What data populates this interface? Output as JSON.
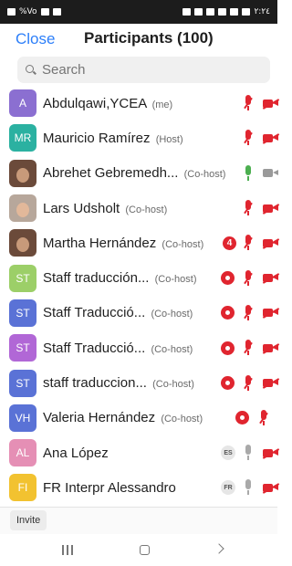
{
  "statusbar": {
    "left_text": "%Vo",
    "right_text": "۲:۲٤"
  },
  "header": {
    "close_label": "Close",
    "title": "Participants (100)"
  },
  "search": {
    "placeholder": "Search"
  },
  "participants": [
    {
      "initials": "A",
      "color": "#8b6fd1",
      "name": "Abdulqawi,YCEA",
      "role": "(me)"
    },
    {
      "initials": "MR",
      "color": "#2bb1a1",
      "name": "Mauricio Ramírez",
      "role": "(Host)"
    },
    {
      "initials": "",
      "color": "#6b4a3a",
      "name": "Abrehet Gebremedh...",
      "role": "(Co-host)"
    },
    {
      "initials": "",
      "color": "#b7a79b",
      "name": "Lars Udsholt",
      "role": "(Co-host)"
    },
    {
      "initials": "",
      "color": "#6b4a3a",
      "name": "Martha Hernández",
      "role": "(Co-host)",
      "badge": "4"
    },
    {
      "initials": "ST",
      "color": "#9ccf68",
      "name": "Staff traducción...",
      "role": "(Co-host)"
    },
    {
      "initials": "ST",
      "color": "#5a72d6",
      "name": "Staff Traducció...",
      "role": "(Co-host)"
    },
    {
      "initials": "ST",
      "color": "#b167d6",
      "name": "Staff Traducció...",
      "role": "(Co-host)"
    },
    {
      "initials": "ST",
      "color": "#5a72d6",
      "name": "staff traduccion...",
      "role": "(Co-host)"
    },
    {
      "initials": "VH",
      "color": "#5a72d6",
      "name": "Valeria Hernández",
      "role": "(Co-host)"
    },
    {
      "initials": "AL",
      "color": "#e58fb5",
      "name": "Ana López",
      "role": "",
      "lang": "ES"
    },
    {
      "initials": "FI",
      "color": "#f2c230",
      "name": "FR Interpr Alessandro",
      "role": "",
      "lang": "FR"
    }
  ],
  "footer": {
    "invite_label": "Invite"
  },
  "colors": {
    "accent": "#2d7ff9",
    "muted_red": "#e0252f",
    "active_green": "#4caf50"
  }
}
